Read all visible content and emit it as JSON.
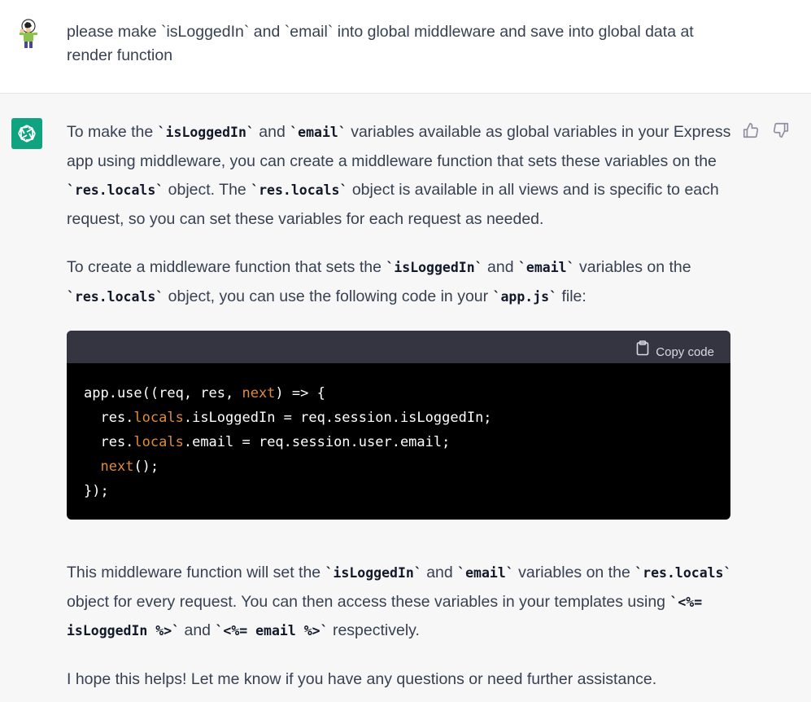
{
  "user_message": {
    "text": "please make `isLoggedIn` and `email` into global middleware and save into global data at render function"
  },
  "assistant_message": {
    "para1": {
      "t1": "To make the ",
      "c1": "`isLoggedIn`",
      "t2": " and ",
      "c2": "`email`",
      "t3": " variables available as global variables in your Express app using middleware, you can create a middleware function that sets these variables on the ",
      "c3": "`res.locals`",
      "t4": " object. The ",
      "c4": "`res.locals`",
      "t5": " object is available in all views and is specific to each request, so you can set these variables for each request as needed."
    },
    "para2": {
      "t1": "To create a middleware function that sets the ",
      "c1": "`isLoggedIn`",
      "t2": " and ",
      "c2": "`email`",
      "t3": " variables on the ",
      "c3": "`res.locals`",
      "t4": " object, you can use the following code in your ",
      "c4": "`app.js`",
      "t5": " file:"
    },
    "code_block": {
      "copy_label": "Copy code",
      "line1_a": "app.use((req, res, ",
      "line1_kw": "next",
      "line1_b": ") => {",
      "line2_a": "  res.",
      "line2_kw": "locals",
      "line2_b": ".isLoggedIn = req.session.isLoggedIn;",
      "line3_a": "  res.",
      "line3_kw": "locals",
      "line3_b": ".email = req.session.user.email;",
      "line4_a": "  ",
      "line4_kw": "next",
      "line4_b": "();",
      "line5": "});"
    },
    "para3": {
      "t1": "This middleware function will set the ",
      "c1": "`isLoggedIn`",
      "t2": " and ",
      "c2": "`email`",
      "t3": " variables on the ",
      "c3": "`res.locals`",
      "t4": " object for every request. You can then access these variables in your templates using ",
      "c4": "`<%= isLoggedIn %>`",
      "t5": " and ",
      "c5": "`<%= email %>`",
      "t6": " respectively."
    },
    "para4": {
      "text": "I hope this helps! Let me know if you have any questions or need further assistance."
    }
  },
  "icons": {
    "user_avatar": "soccer-player-avatar-icon",
    "assistant_avatar": "openai-logo-icon",
    "thumbs_up": "thumbs-up-icon",
    "thumbs_down": "thumbs-down-icon",
    "copy": "clipboard-icon"
  },
  "colors": {
    "assistant_avatar_bg": "#10a37f",
    "code_keyword": "#df8b3b",
    "code_header_bg": "#343541",
    "code_bg": "#000000"
  }
}
